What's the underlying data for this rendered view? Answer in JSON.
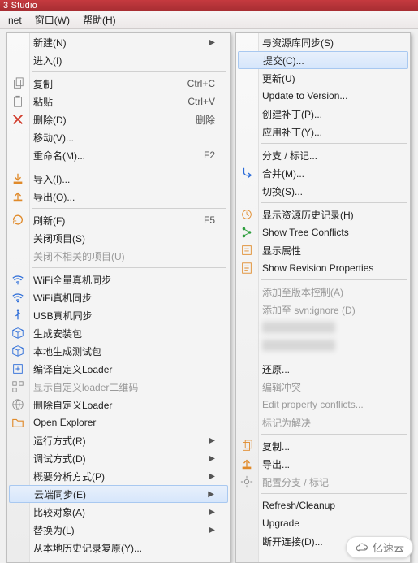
{
  "titlebar": {
    "text": "3 Studio"
  },
  "menubar": {
    "items": [
      "net",
      "窗口(W)",
      "帮助(H)"
    ]
  },
  "left_menu": {
    "groups": [
      [
        {
          "label": "新建(N)",
          "submenu": true,
          "icon": ""
        },
        {
          "label": "进入(I)",
          "icon": ""
        }
      ],
      [
        {
          "label": "复制",
          "shortcut": "Ctrl+C",
          "icon": "copy-icon",
          "color": "c-grey"
        },
        {
          "label": "粘贴",
          "shortcut": "Ctrl+V",
          "icon": "paste-icon",
          "color": "c-grey"
        },
        {
          "label": "删除(D)",
          "shortcut": "删除",
          "icon": "delete-icon",
          "color": "c-red"
        },
        {
          "label": "移动(V)...",
          "icon": ""
        },
        {
          "label": "重命名(M)...",
          "shortcut": "F2",
          "icon": ""
        }
      ],
      [
        {
          "label": "导入(I)...",
          "icon": "import-icon",
          "color": "c-orange"
        },
        {
          "label": "导出(O)...",
          "icon": "export-icon",
          "color": "c-orange"
        }
      ],
      [
        {
          "label": "刷新(F)",
          "shortcut": "F5",
          "icon": "refresh-icon",
          "color": "c-orange"
        },
        {
          "label": "关闭项目(S)",
          "icon": ""
        },
        {
          "label": "关闭不相关的项目(U)",
          "disabled": true,
          "icon": ""
        }
      ],
      [
        {
          "label": "WiFi全量真机同步",
          "icon": "wifi-icon",
          "color": "c-blue"
        },
        {
          "label": "WiFi真机同步",
          "icon": "wifi-icon",
          "color": "c-blue"
        },
        {
          "label": "USB真机同步",
          "icon": "usb-icon",
          "color": "c-blue"
        },
        {
          "label": "生成安装包",
          "icon": "package-icon",
          "color": "c-blue"
        },
        {
          "label": "本地生成测试包",
          "icon": "package-icon",
          "color": "c-blue"
        },
        {
          "label": "编译自定义Loader",
          "icon": "build-icon",
          "color": "c-blue"
        },
        {
          "label": "显示自定义loader二维码",
          "disabled": true,
          "icon": "qr-icon",
          "color": "c-grey"
        },
        {
          "label": "删除自定义Loader",
          "icon": "globe-icon",
          "color": "c-grey"
        },
        {
          "label": "Open Explorer",
          "icon": "folder-icon",
          "color": "c-orange"
        },
        {
          "label": "运行方式(R)",
          "submenu": true,
          "icon": ""
        },
        {
          "label": "调试方式(D)",
          "submenu": true,
          "icon": ""
        },
        {
          "label": "概要分析方式(P)",
          "submenu": true,
          "icon": ""
        },
        {
          "label": "云端同步(E)",
          "submenu": true,
          "highlight": true,
          "icon": ""
        },
        {
          "label": "比较对象(A)",
          "submenu": true,
          "icon": ""
        },
        {
          "label": "替换为(L)",
          "submenu": true,
          "icon": ""
        },
        {
          "label": "从本地历史记录复原(Y)...",
          "icon": ""
        }
      ]
    ]
  },
  "right_menu": {
    "groups": [
      [
        {
          "label": "与资源库同步(S)"
        },
        {
          "label": "提交(C)...",
          "highlight": true
        },
        {
          "label": "更新(U)"
        },
        {
          "label": "Update to Version..."
        },
        {
          "label": "创建补丁(P)..."
        },
        {
          "label": "应用补丁(Y)..."
        }
      ],
      [
        {
          "label": "分支 / 标记..."
        },
        {
          "label": "合并(M)...",
          "icon": "merge-icon",
          "color": "c-blue"
        },
        {
          "label": "切换(S)..."
        }
      ],
      [
        {
          "label": "显示资源历史记录(H)",
          "icon": "history-icon",
          "color": "c-orange"
        },
        {
          "label": "Show Tree Conflicts",
          "icon": "tree-icon",
          "color": "c-green"
        },
        {
          "label": "显示属性",
          "icon": "properties-icon",
          "color": "c-orange"
        },
        {
          "label": "Show Revision Properties",
          "icon": "revprops-icon",
          "color": "c-orange"
        }
      ],
      [
        {
          "label": "添加至版本控制(A)",
          "disabled": true
        },
        {
          "label": "添加至 svn:ignore (D)",
          "disabled": true
        },
        {
          "blurred": true
        },
        {
          "blurred": true
        }
      ],
      [
        {
          "label": "还原..."
        },
        {
          "label": "编辑冲突",
          "disabled": true
        },
        {
          "label": "Edit property conflicts...",
          "disabled": true
        },
        {
          "label": "标记为解决",
          "disabled": true
        }
      ],
      [
        {
          "label": "复制...",
          "icon": "copy-icon",
          "color": "c-orange"
        },
        {
          "label": "导出...",
          "icon": "export-icon",
          "color": "c-orange"
        },
        {
          "label": "配置分支 / 标记",
          "disabled": true,
          "icon": "config-icon",
          "color": "c-grey"
        }
      ],
      [
        {
          "label": "Refresh/Cleanup"
        },
        {
          "label": "Upgrade"
        },
        {
          "label": "断开连接(D)..."
        }
      ]
    ]
  },
  "watermark": {
    "text": "亿速云"
  }
}
